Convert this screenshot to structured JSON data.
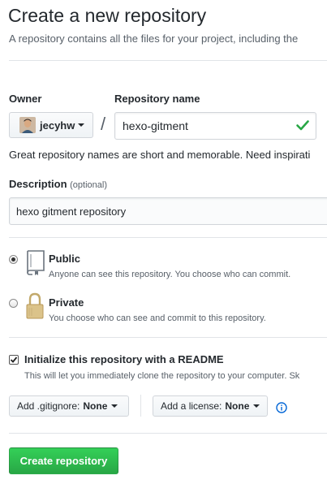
{
  "header": {
    "title": "Create a new repository",
    "subtitle": "A repository contains all the files for your project, including the"
  },
  "owner": {
    "label": "Owner",
    "selected": "jecyhw"
  },
  "repository": {
    "label": "Repository name",
    "separator": "/",
    "value": "hexo-gitment",
    "hint": "Great repository names are short and memorable. Need inspirati"
  },
  "description": {
    "label": "Description",
    "optional": "(optional)",
    "value": "hexo gitment repository"
  },
  "visibility": {
    "public": {
      "title": "Public",
      "desc": "Anyone can see this repository. You choose who can commit.",
      "checked": true
    },
    "private": {
      "title": "Private",
      "desc": "You choose who can see and commit to this repository.",
      "checked": false
    }
  },
  "init": {
    "label": "Initialize this repository with a README",
    "desc": "This will let you immediately clone the repository to your computer. Sk",
    "checked": true
  },
  "gitignore": {
    "label": "Add .gitignore:",
    "value": "None"
  },
  "license": {
    "label": "Add a license:",
    "value": "None"
  },
  "submit": {
    "label": "Create repository"
  },
  "colors": {
    "accent_green": "#28a745",
    "check_green": "#28a745",
    "info_blue": "#0366d6",
    "text": "#24292e",
    "muted": "#586069"
  },
  "icons": {
    "check": "check-icon",
    "public_repo": "repo-icon",
    "private_repo": "lock-icon",
    "info": "info-icon"
  }
}
